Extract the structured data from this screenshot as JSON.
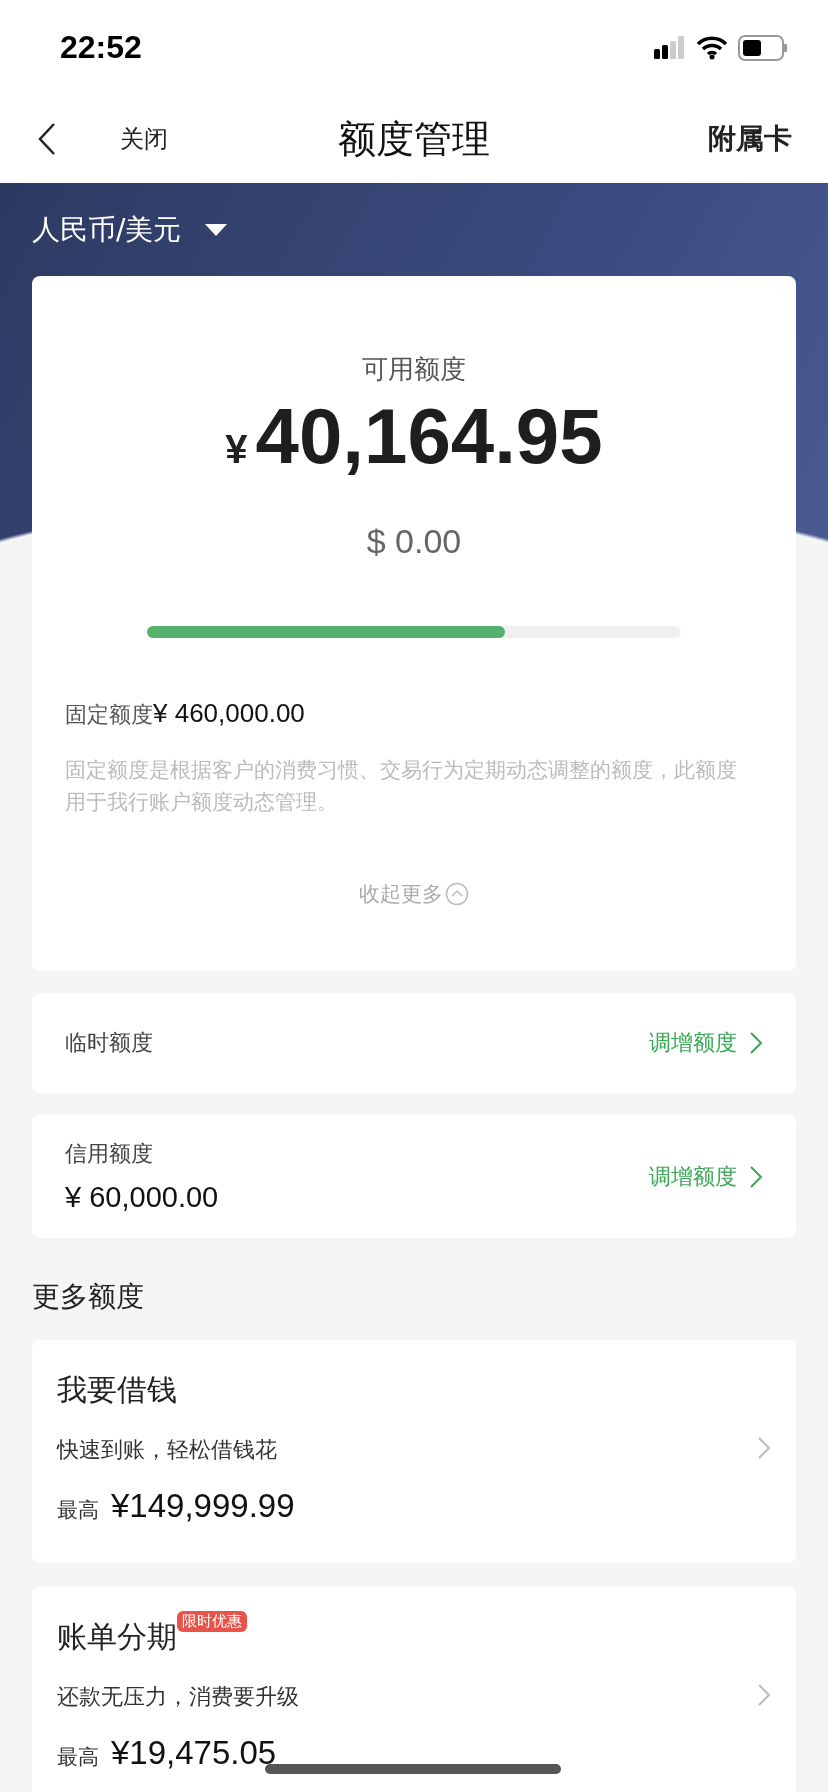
{
  "status_bar": {
    "time": "22:52"
  },
  "nav": {
    "close": "关闭",
    "title": "额度管理",
    "action": "附属卡"
  },
  "currency": {
    "label": "人民币/美元"
  },
  "available": {
    "label": "可用额度",
    "symbol": "¥",
    "amount": "40,164.95",
    "usd": "$ 0.00",
    "level": 0.67,
    "fixed_label": "固定额度",
    "fixed_amount": "¥ 460,000.00",
    "description": "固定额度是根据客户的消费习惯、交易行为定期动态调整的额度，此额度用于我行账户额度动态管理。",
    "collapse": "收起更多",
    "expanded": true
  },
  "limits": [
    {
      "label": "临时额度",
      "action": "调增额度"
    },
    {
      "label": "信用额度",
      "amount": "¥ 60,000.00",
      "action": "调增额度"
    }
  ],
  "more": {
    "title": "更多额度",
    "items": [
      {
        "title": "我要借钱",
        "subtitle": "快速到账，轻松借钱花",
        "prefix": "最高",
        "amount": "¥149,999.99"
      },
      {
        "title": "账单分期",
        "badge": "限时优惠",
        "subtitle": "还款无压力，消费要升级",
        "prefix": "最高",
        "amount": "¥19,475.05"
      }
    ]
  }
}
